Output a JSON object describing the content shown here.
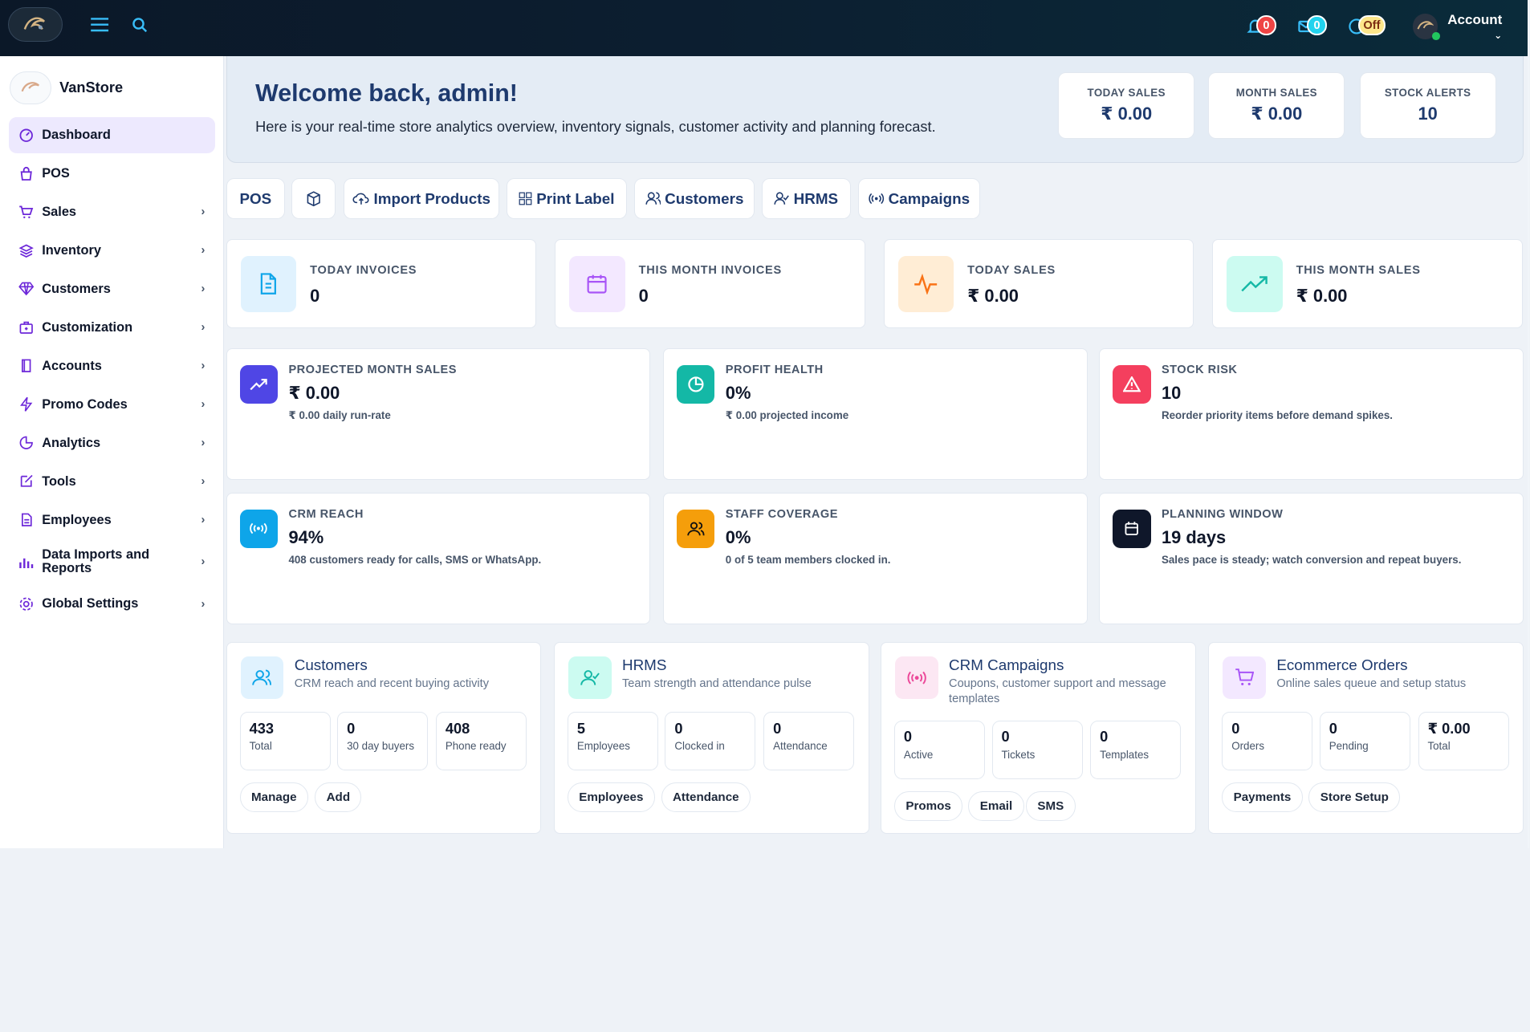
{
  "topbar": {
    "notifications": "0",
    "messages": "0",
    "status": "Off",
    "account_label": "Account"
  },
  "sidebar": {
    "brand": "VanStore",
    "items": [
      {
        "label": "Dashboard",
        "icon": "dashboard-icon",
        "active": true
      },
      {
        "label": "POS",
        "icon": "bag-icon"
      },
      {
        "label": "Sales",
        "icon": "cart-icon"
      },
      {
        "label": "Inventory",
        "icon": "layers-icon"
      },
      {
        "label": "Customers",
        "icon": "diamond-icon"
      },
      {
        "label": "Customization",
        "icon": "briefcase-icon"
      },
      {
        "label": "Accounts",
        "icon": "book-icon"
      },
      {
        "label": "Promo Codes",
        "icon": "bolt-icon"
      },
      {
        "label": "Analytics",
        "icon": "pie-icon"
      },
      {
        "label": "Tools",
        "icon": "edit-icon"
      },
      {
        "label": "Employees",
        "icon": "file-icon"
      },
      {
        "label": "Data Imports and Reports",
        "icon": "bar-chart-icon"
      },
      {
        "label": "Global Settings",
        "icon": "gear-icon"
      }
    ]
  },
  "hero": {
    "title": "Welcome back, admin!",
    "subtitle": "Here is your real-time store analytics overview, inventory signals, customer activity and planning forecast.",
    "stats": [
      {
        "label": "TODAY SALES",
        "value": "₹ 0.00"
      },
      {
        "label": "MONTH SALES",
        "value": "₹ 0.00"
      },
      {
        "label": "STOCK ALERTS",
        "value": "10"
      }
    ]
  },
  "quick_actions": [
    {
      "label": "POS"
    },
    {
      "label": ""
    },
    {
      "label": "Import Products"
    },
    {
      "label": "Print Label"
    },
    {
      "label": "Customers"
    },
    {
      "label": "HRMS"
    },
    {
      "label": "Campaigns"
    }
  ],
  "kpis": [
    {
      "label": "TODAY INVOICES",
      "value": "0",
      "color": "#e0f2fe"
    },
    {
      "label": "THIS MONTH INVOICES",
      "value": "0",
      "color": "#f3e8ff"
    },
    {
      "label": "TODAY SALES",
      "value": "₹ 0.00",
      "color": "#ffedd5"
    },
    {
      "label": "THIS MONTH SALES",
      "value": "₹ 0.00",
      "color": "#ccfbf1"
    }
  ],
  "insights": [
    {
      "label": "PROJECTED MONTH SALES",
      "value": "₹ 0.00",
      "sub": "₹ 0.00 daily run-rate",
      "color": "#4f46e5"
    },
    {
      "label": "PROFIT HEALTH",
      "value": "0%",
      "sub": "₹ 0.00 projected income",
      "color": "#14b8a6"
    },
    {
      "label": "STOCK RISK",
      "value": "10",
      "sub": "Reorder priority items before demand spikes.",
      "color": "#f43f5e"
    },
    {
      "label": "CRM REACH",
      "value": "94%",
      "sub": "408 customers ready for calls, SMS or WhatsApp.",
      "color": "#0ea5e9"
    },
    {
      "label": "STAFF COVERAGE",
      "value": "0%",
      "sub": "0 of 5 team members clocked in.",
      "color": "#f59e0b"
    },
    {
      "label": "PLANNING WINDOW",
      "value": "19 days",
      "sub": "Sales pace is steady; watch conversion and repeat buyers.",
      "color": "#0f172a"
    }
  ],
  "modules": [
    {
      "title": "Customers",
      "sub": "CRM reach and recent buying activity",
      "stats": [
        {
          "v": "433",
          "l": "Total"
        },
        {
          "v": "0",
          "l": "30 day buyers"
        },
        {
          "v": "408",
          "l": "Phone ready"
        }
      ],
      "buttons": [
        "Manage",
        "Add"
      ]
    },
    {
      "title": "HRMS",
      "sub": "Team strength and attendance pulse",
      "stats": [
        {
          "v": "5",
          "l": "Employees"
        },
        {
          "v": "0",
          "l": "Clocked in"
        },
        {
          "v": "0",
          "l": "Attendance"
        }
      ],
      "buttons": [
        "Employees",
        "Attendance"
      ]
    },
    {
      "title": "CRM Campaigns",
      "sub": "Coupons, customer support and message templates",
      "stats": [
        {
          "v": "0",
          "l": "Active"
        },
        {
          "v": "0",
          "l": "Tickets"
        },
        {
          "v": "0",
          "l": "Templates"
        }
      ],
      "buttons": [
        "Promos",
        "Email",
        "SMS"
      ]
    },
    {
      "title": "Ecommerce Orders",
      "sub": "Online sales queue and setup status",
      "stats": [
        {
          "v": "0",
          "l": "Orders"
        },
        {
          "v": "0",
          "l": "Pending"
        },
        {
          "v": "₹ 0.00",
          "l": "Total"
        }
      ],
      "buttons": [
        "Payments",
        "Store Setup"
      ]
    }
  ]
}
